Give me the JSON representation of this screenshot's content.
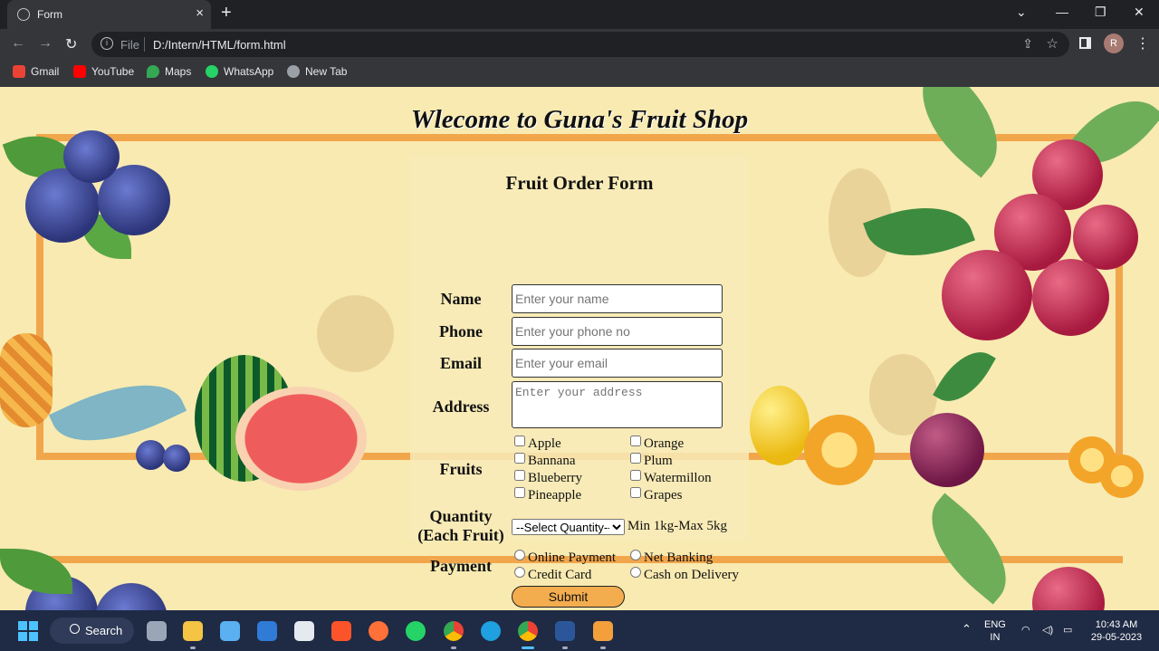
{
  "browser": {
    "tab_title": "Form",
    "new_tab": "+",
    "close_tab": "×",
    "file_label": "File",
    "url": "D:/Intern/HTML/form.html",
    "profile_initial": "R",
    "bookmarks": [
      {
        "label": "Gmail",
        "color": "#ea4335"
      },
      {
        "label": "YouTube",
        "color": "#ff0000"
      },
      {
        "label": "Maps",
        "color": "#34a853"
      },
      {
        "label": "WhatsApp",
        "color": "#25d366"
      },
      {
        "label": "New Tab",
        "color": "#9aa0a6"
      }
    ]
  },
  "page": {
    "heading": "Wlecome to Guna's Fruit Shop",
    "form_title": "Fruit Order Form",
    "labels": {
      "name": "Name",
      "phone": "Phone",
      "email": "Email",
      "address": "Address",
      "fruits": "Fruits",
      "quantity_line1": "Quantity",
      "quantity_line2": "(Each Fruit)",
      "payment": "Payment"
    },
    "placeholders": {
      "name": "Enter your name",
      "phone": "Enter your phone no",
      "email": "Enter your email",
      "address": "Enter your address"
    },
    "fruits": [
      "Apple",
      "Orange",
      "Bannana",
      "Plum",
      "Blueberry",
      "Watermillon",
      "Pineapple",
      "Grapes"
    ],
    "quantity_selected": "--Select Quantity--",
    "quantity_note": "Min 1kg-Max 5kg",
    "payment_options": [
      "Online Payment",
      "Net Banking",
      "Credit Card",
      "Cash on Delivery"
    ],
    "submit_label": "Submit"
  },
  "taskbar": {
    "search_label": "Search",
    "lang_line1": "ENG",
    "lang_line2": "IN",
    "time": "10:43 AM",
    "date": "29-05-2023"
  }
}
